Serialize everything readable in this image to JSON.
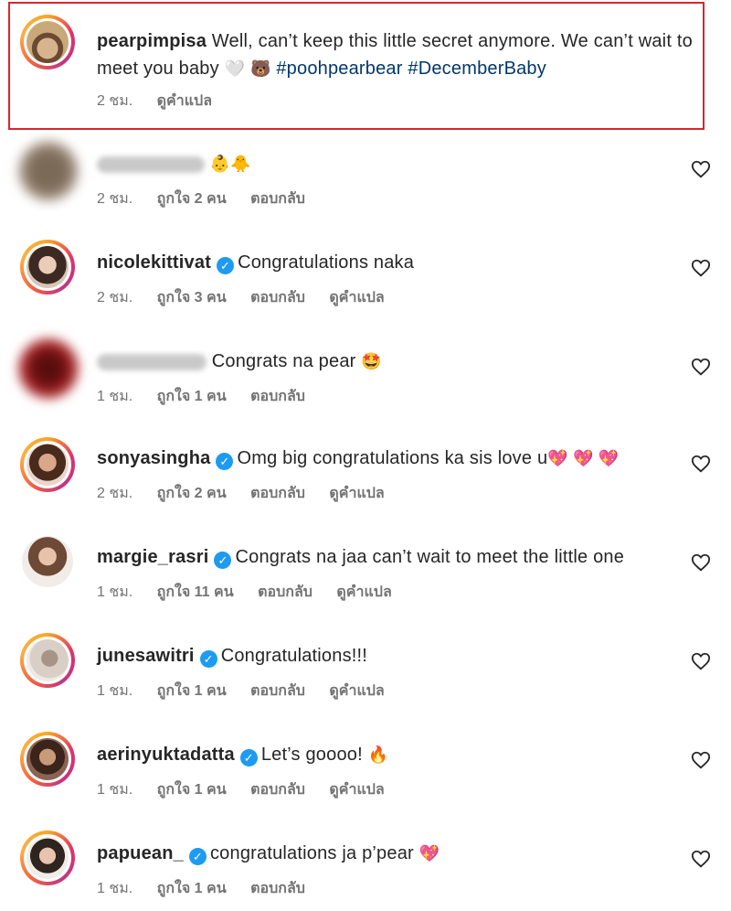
{
  "caption": {
    "username": "pearpimpisa",
    "text": "Well, can’t keep this little secret anymore. We can’t wait to meet you baby",
    "emoji1": "🤍",
    "emoji2": "🐻",
    "hashtag1": "#poohpearbear",
    "hashtag2": "#DecemberBaby",
    "time": "2 ชม.",
    "translate": "ดูคำแปล"
  },
  "comments": [
    {
      "username": "",
      "verified": false,
      "text": "",
      "emoji": "👶🐥",
      "time": "2 ชม.",
      "likes": "ถูกใจ 2 คน",
      "reply": "ตอบกลับ",
      "translate": ""
    },
    {
      "username": "nicolekittivat",
      "verified": true,
      "text": "Congratulations naka",
      "time": "2 ชม.",
      "likes": "ถูกใจ 3 คน",
      "reply": "ตอบกลับ",
      "translate": "ดูคำแปล"
    },
    {
      "username": "",
      "verified": false,
      "text": "Congrats na pear",
      "emoji": "🤩",
      "time": "1 ชม.",
      "likes": "ถูกใจ 1 คน",
      "reply": "ตอบกลับ",
      "translate": ""
    },
    {
      "username": "sonyasingha",
      "verified": true,
      "text": "Omg big congratulations ka sis love u",
      "emoji": "💖 💖 💖",
      "time": "2 ชม.",
      "likes": "ถูกใจ 2 คน",
      "reply": "ตอบกลับ",
      "translate": "ดูคำแปล"
    },
    {
      "username": "margie_rasri",
      "verified": true,
      "text": "Congrats na jaa can’t wait to meet the little one",
      "time": "1 ชม.",
      "likes": "ถูกใจ 11 คน",
      "reply": "ตอบกลับ",
      "translate": "ดูคำแปล"
    },
    {
      "username": "junesawitri",
      "verified": true,
      "text": "Congratulations!!!",
      "time": "1 ชม.",
      "likes": "ถูกใจ 1 คน",
      "reply": "ตอบกลับ",
      "translate": "ดูคำแปล"
    },
    {
      "username": "aerinyuktadatta",
      "verified": true,
      "text": "Let’s goooo!",
      "emoji": "🔥",
      "time": "1 ชม.",
      "likes": "ถูกใจ 1 คน",
      "reply": "ตอบกลับ",
      "translate": "ดูคำแปล"
    },
    {
      "username": "papuean_",
      "verified": true,
      "text": "congratulations ja p’pear",
      "emoji": "💖",
      "time": "1 ชม.",
      "likes": "ถูกใจ 1 คน",
      "reply": "ตอบกลับ",
      "translate": ""
    }
  ],
  "icons": {
    "verified": "verified-badge-icon",
    "like": "heart-outline-icon"
  },
  "colors": {
    "highlight_border": "#d9262c",
    "hashtag": "#00376b",
    "verified": "#1d9bf0"
  }
}
